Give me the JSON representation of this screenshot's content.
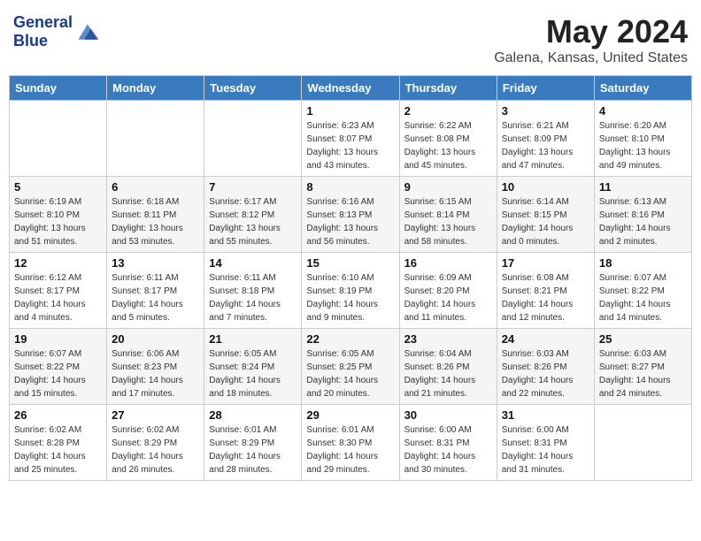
{
  "header": {
    "logo_line1": "General",
    "logo_line2": "Blue",
    "month": "May 2024",
    "location": "Galena, Kansas, United States"
  },
  "weekdays": [
    "Sunday",
    "Monday",
    "Tuesday",
    "Wednesday",
    "Thursday",
    "Friday",
    "Saturday"
  ],
  "weeks": [
    [
      {
        "day": "",
        "sunrise": "",
        "sunset": "",
        "daylight": ""
      },
      {
        "day": "",
        "sunrise": "",
        "sunset": "",
        "daylight": ""
      },
      {
        "day": "",
        "sunrise": "",
        "sunset": "",
        "daylight": ""
      },
      {
        "day": "1",
        "sunrise": "Sunrise: 6:23 AM",
        "sunset": "Sunset: 8:07 PM",
        "daylight": "Daylight: 13 hours and 43 minutes."
      },
      {
        "day": "2",
        "sunrise": "Sunrise: 6:22 AM",
        "sunset": "Sunset: 8:08 PM",
        "daylight": "Daylight: 13 hours and 45 minutes."
      },
      {
        "day": "3",
        "sunrise": "Sunrise: 6:21 AM",
        "sunset": "Sunset: 8:09 PM",
        "daylight": "Daylight: 13 hours and 47 minutes."
      },
      {
        "day": "4",
        "sunrise": "Sunrise: 6:20 AM",
        "sunset": "Sunset: 8:10 PM",
        "daylight": "Daylight: 13 hours and 49 minutes."
      }
    ],
    [
      {
        "day": "5",
        "sunrise": "Sunrise: 6:19 AM",
        "sunset": "Sunset: 8:10 PM",
        "daylight": "Daylight: 13 hours and 51 minutes."
      },
      {
        "day": "6",
        "sunrise": "Sunrise: 6:18 AM",
        "sunset": "Sunset: 8:11 PM",
        "daylight": "Daylight: 13 hours and 53 minutes."
      },
      {
        "day": "7",
        "sunrise": "Sunrise: 6:17 AM",
        "sunset": "Sunset: 8:12 PM",
        "daylight": "Daylight: 13 hours and 55 minutes."
      },
      {
        "day": "8",
        "sunrise": "Sunrise: 6:16 AM",
        "sunset": "Sunset: 8:13 PM",
        "daylight": "Daylight: 13 hours and 56 minutes."
      },
      {
        "day": "9",
        "sunrise": "Sunrise: 6:15 AM",
        "sunset": "Sunset: 8:14 PM",
        "daylight": "Daylight: 13 hours and 58 minutes."
      },
      {
        "day": "10",
        "sunrise": "Sunrise: 6:14 AM",
        "sunset": "Sunset: 8:15 PM",
        "daylight": "Daylight: 14 hours and 0 minutes."
      },
      {
        "day": "11",
        "sunrise": "Sunrise: 6:13 AM",
        "sunset": "Sunset: 8:16 PM",
        "daylight": "Daylight: 14 hours and 2 minutes."
      }
    ],
    [
      {
        "day": "12",
        "sunrise": "Sunrise: 6:12 AM",
        "sunset": "Sunset: 8:17 PM",
        "daylight": "Daylight: 14 hours and 4 minutes."
      },
      {
        "day": "13",
        "sunrise": "Sunrise: 6:11 AM",
        "sunset": "Sunset: 8:17 PM",
        "daylight": "Daylight: 14 hours and 5 minutes."
      },
      {
        "day": "14",
        "sunrise": "Sunrise: 6:11 AM",
        "sunset": "Sunset: 8:18 PM",
        "daylight": "Daylight: 14 hours and 7 minutes."
      },
      {
        "day": "15",
        "sunrise": "Sunrise: 6:10 AM",
        "sunset": "Sunset: 8:19 PM",
        "daylight": "Daylight: 14 hours and 9 minutes."
      },
      {
        "day": "16",
        "sunrise": "Sunrise: 6:09 AM",
        "sunset": "Sunset: 8:20 PM",
        "daylight": "Daylight: 14 hours and 11 minutes."
      },
      {
        "day": "17",
        "sunrise": "Sunrise: 6:08 AM",
        "sunset": "Sunset: 8:21 PM",
        "daylight": "Daylight: 14 hours and 12 minutes."
      },
      {
        "day": "18",
        "sunrise": "Sunrise: 6:07 AM",
        "sunset": "Sunset: 8:22 PM",
        "daylight": "Daylight: 14 hours and 14 minutes."
      }
    ],
    [
      {
        "day": "19",
        "sunrise": "Sunrise: 6:07 AM",
        "sunset": "Sunset: 8:22 PM",
        "daylight": "Daylight: 14 hours and 15 minutes."
      },
      {
        "day": "20",
        "sunrise": "Sunrise: 6:06 AM",
        "sunset": "Sunset: 8:23 PM",
        "daylight": "Daylight: 14 hours and 17 minutes."
      },
      {
        "day": "21",
        "sunrise": "Sunrise: 6:05 AM",
        "sunset": "Sunset: 8:24 PM",
        "daylight": "Daylight: 14 hours and 18 minutes."
      },
      {
        "day": "22",
        "sunrise": "Sunrise: 6:05 AM",
        "sunset": "Sunset: 8:25 PM",
        "daylight": "Daylight: 14 hours and 20 minutes."
      },
      {
        "day": "23",
        "sunrise": "Sunrise: 6:04 AM",
        "sunset": "Sunset: 8:26 PM",
        "daylight": "Daylight: 14 hours and 21 minutes."
      },
      {
        "day": "24",
        "sunrise": "Sunrise: 6:03 AM",
        "sunset": "Sunset: 8:26 PM",
        "daylight": "Daylight: 14 hours and 22 minutes."
      },
      {
        "day": "25",
        "sunrise": "Sunrise: 6:03 AM",
        "sunset": "Sunset: 8:27 PM",
        "daylight": "Daylight: 14 hours and 24 minutes."
      }
    ],
    [
      {
        "day": "26",
        "sunrise": "Sunrise: 6:02 AM",
        "sunset": "Sunset: 8:28 PM",
        "daylight": "Daylight: 14 hours and 25 minutes."
      },
      {
        "day": "27",
        "sunrise": "Sunrise: 6:02 AM",
        "sunset": "Sunset: 8:29 PM",
        "daylight": "Daylight: 14 hours and 26 minutes."
      },
      {
        "day": "28",
        "sunrise": "Sunrise: 6:01 AM",
        "sunset": "Sunset: 8:29 PM",
        "daylight": "Daylight: 14 hours and 28 minutes."
      },
      {
        "day": "29",
        "sunrise": "Sunrise: 6:01 AM",
        "sunset": "Sunset: 8:30 PM",
        "daylight": "Daylight: 14 hours and 29 minutes."
      },
      {
        "day": "30",
        "sunrise": "Sunrise: 6:00 AM",
        "sunset": "Sunset: 8:31 PM",
        "daylight": "Daylight: 14 hours and 30 minutes."
      },
      {
        "day": "31",
        "sunrise": "Sunrise: 6:00 AM",
        "sunset": "Sunset: 8:31 PM",
        "daylight": "Daylight: 14 hours and 31 minutes."
      },
      {
        "day": "",
        "sunrise": "",
        "sunset": "",
        "daylight": ""
      }
    ]
  ]
}
